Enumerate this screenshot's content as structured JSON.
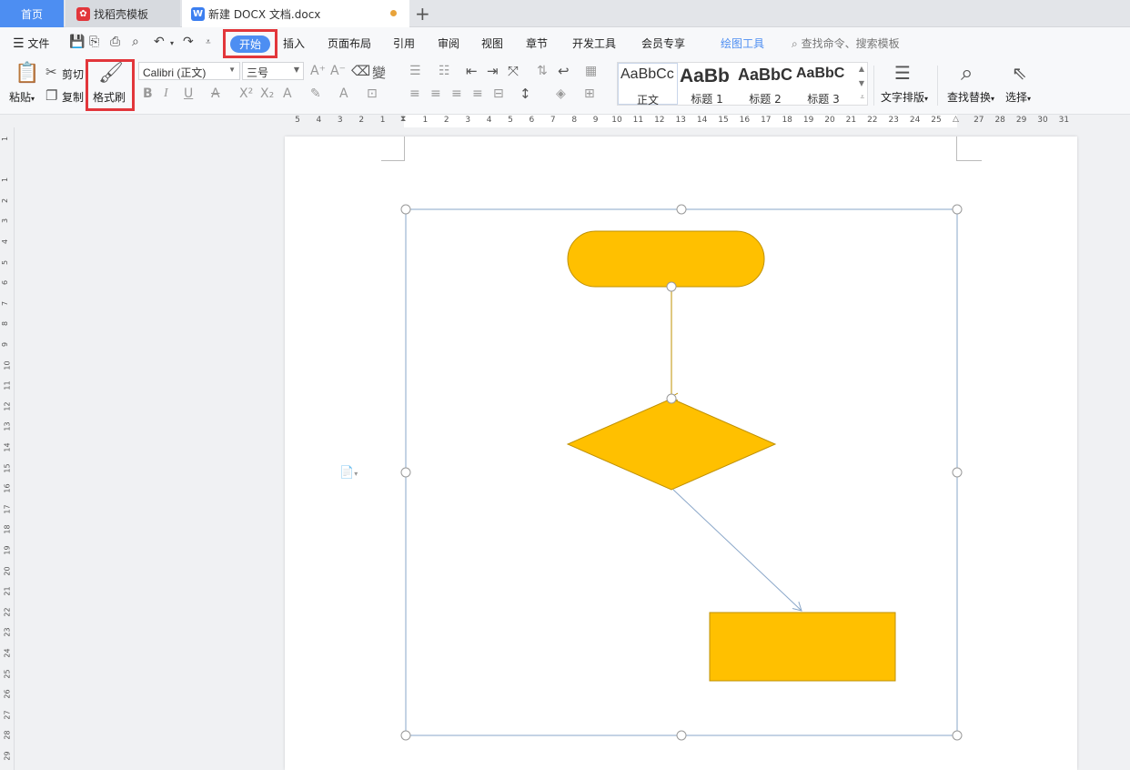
{
  "tabs": {
    "home": "首页",
    "template": "找稻壳模板",
    "document": "新建 DOCX 文档.docx",
    "new_tab": "+"
  },
  "menu": {
    "file": "文件",
    "start": "开始",
    "insert": "插入",
    "page_layout": "页面布局",
    "reference": "引用",
    "review": "审阅",
    "view": "视图",
    "chapter": "章节",
    "developer": "开发工具",
    "member": "会员专享",
    "drawing_tools": "绘图工具",
    "search_placeholder": "查找命令、搜索模板"
  },
  "ribbon": {
    "paste": "粘贴",
    "cut": "剪切",
    "copy": "复制",
    "format_painter": "格式刷",
    "font_name": "Calibri (正文)",
    "font_size": "三号",
    "styles": [
      {
        "preview": "AaBbCc",
        "name": "正文"
      },
      {
        "preview": "AaBb",
        "name": "标题 1"
      },
      {
        "preview": "AaBbC",
        "name": "标题 2"
      },
      {
        "preview": "AaBbC",
        "name": "标题 3"
      }
    ],
    "text_layout": "文字排版",
    "find_replace": "查找替换",
    "select": "选择"
  },
  "ruler": {
    "horizontal": [
      "5",
      "4",
      "3",
      "2",
      "1",
      "",
      "1",
      "2",
      "3",
      "4",
      "5",
      "6",
      "7",
      "8",
      "9",
      "10",
      "11",
      "12",
      "13",
      "14",
      "15",
      "16",
      "17",
      "18",
      "19",
      "20",
      "21",
      "22",
      "23",
      "24",
      "25",
      "",
      "27",
      "28",
      "29",
      "30",
      "31"
    ],
    "vertical": [
      "1",
      "",
      "1",
      "2",
      "3",
      "4",
      "5",
      "6",
      "7",
      "8",
      "9",
      "10",
      "11",
      "12",
      "13",
      "14",
      "15",
      "16",
      "17",
      "18",
      "19",
      "20",
      "21",
      "22",
      "23",
      "24",
      "25",
      "26",
      "27",
      "28",
      "29"
    ]
  },
  "colors": {
    "shape_fill": "#FFC000",
    "shape_stroke": "#BF9000",
    "accent": "#4D8EF2",
    "highlight": "#E2363B",
    "selection": "#8AA7C9"
  }
}
